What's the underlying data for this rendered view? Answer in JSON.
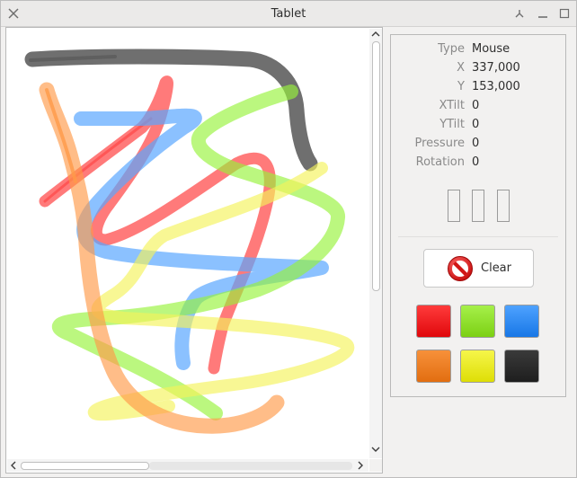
{
  "window": {
    "title": "Tablet",
    "close_icon": "close-icon",
    "pin_icon": "pin-icon",
    "minimize_icon": "minimize-icon",
    "maximize_icon": "maximize-icon"
  },
  "info": {
    "rows": [
      {
        "label": "Type",
        "value": "Mouse"
      },
      {
        "label": "X",
        "value": "337,000"
      },
      {
        "label": "Y",
        "value": "153,000"
      },
      {
        "label": "XTilt",
        "value": "0"
      },
      {
        "label": "YTilt",
        "value": "0"
      },
      {
        "label": "Pressure",
        "value": "0"
      },
      {
        "label": "Rotation",
        "value": "0"
      }
    ]
  },
  "controls": {
    "clear_label": "Clear",
    "clear_icon": "no-entry-icon"
  },
  "palette": {
    "colors": [
      {
        "name": "red",
        "hex": "#e8151a"
      },
      {
        "name": "green",
        "hex": "#8fe01c"
      },
      {
        "name": "blue",
        "hex": "#2a88f0"
      },
      {
        "name": "orange",
        "hex": "#ee7b1d"
      },
      {
        "name": "yellow",
        "hex": "#e8e80f"
      },
      {
        "name": "black",
        "hex": "#262626"
      }
    ]
  },
  "strokes": [
    {
      "color": "#5d5d5d"
    },
    {
      "color": "#ff4b4b"
    },
    {
      "color": "#6fb4ff"
    },
    {
      "color": "#9af238"
    },
    {
      "color": "#fbf56f"
    },
    {
      "color": "#ffa75f"
    }
  ]
}
